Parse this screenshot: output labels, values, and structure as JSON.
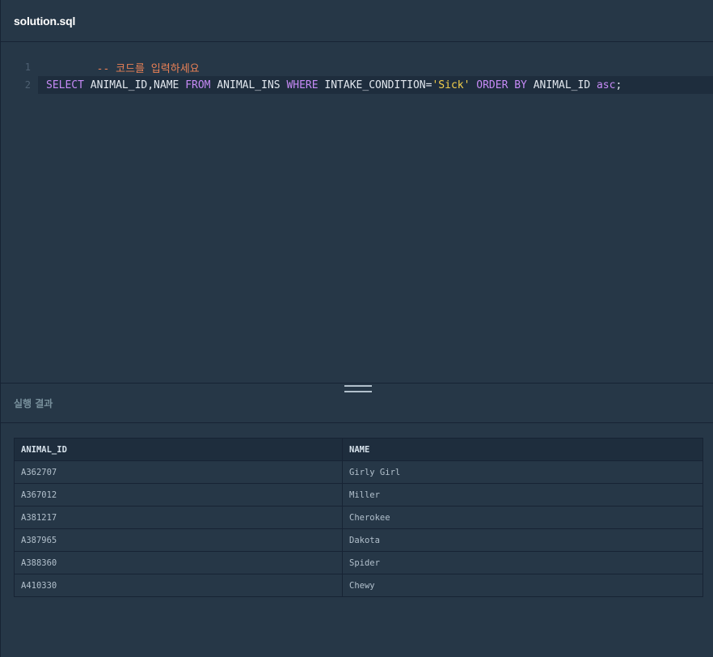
{
  "file_tab": {
    "name": "solution.sql"
  },
  "editor": {
    "lines": [
      {
        "number": "1",
        "tokens": [
          {
            "type": "comment",
            "text": "-- 코드를 입력하세요"
          }
        ]
      },
      {
        "number": "2",
        "tokens": [
          {
            "type": "keyword",
            "text": "SELECT"
          },
          {
            "type": "plain",
            "text": " ANIMAL_ID,NAME "
          },
          {
            "type": "keyword",
            "text": "FROM"
          },
          {
            "type": "plain",
            "text": " ANIMAL_INS "
          },
          {
            "type": "keyword",
            "text": "WHERE"
          },
          {
            "type": "plain",
            "text": " INTAKE_CONDITION="
          },
          {
            "type": "string",
            "text": "'Sick'"
          },
          {
            "type": "plain",
            "text": " "
          },
          {
            "type": "keyword",
            "text": "ORDER BY"
          },
          {
            "type": "plain",
            "text": " ANIMAL_ID "
          },
          {
            "type": "keyword",
            "text": "asc"
          },
          {
            "type": "plain",
            "text": ";"
          }
        ]
      }
    ]
  },
  "results": {
    "title": "실행 결과",
    "columns": [
      "ANIMAL_ID",
      "NAME"
    ],
    "rows": [
      [
        "A362707",
        "Girly Girl"
      ],
      [
        "A367012",
        "Miller"
      ],
      [
        "A381217",
        "Cherokee"
      ],
      [
        "A387965",
        "Dakota"
      ],
      [
        "A388360",
        "Spider"
      ],
      [
        "A410330",
        "Chewy"
      ]
    ]
  },
  "colors": {
    "background": "#263747",
    "comment": "#ea8156",
    "keyword": "#c68af6",
    "string": "#f4d04c",
    "plain": "#e1e7ee"
  }
}
